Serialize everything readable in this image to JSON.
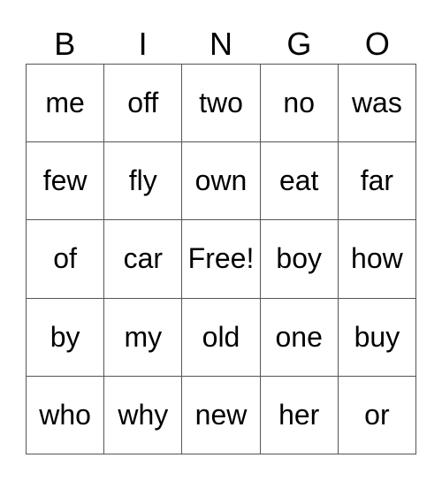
{
  "header": [
    "B",
    "I",
    "N",
    "G",
    "O"
  ],
  "cells": [
    [
      "me",
      "off",
      "two",
      "no",
      "was"
    ],
    [
      "few",
      "fly",
      "own",
      "eat",
      "far"
    ],
    [
      "of",
      "car",
      "Free!",
      "boy",
      "how"
    ],
    [
      "by",
      "my",
      "old",
      "one",
      "buy"
    ],
    [
      "who",
      "why",
      "new",
      "her",
      "or"
    ]
  ]
}
